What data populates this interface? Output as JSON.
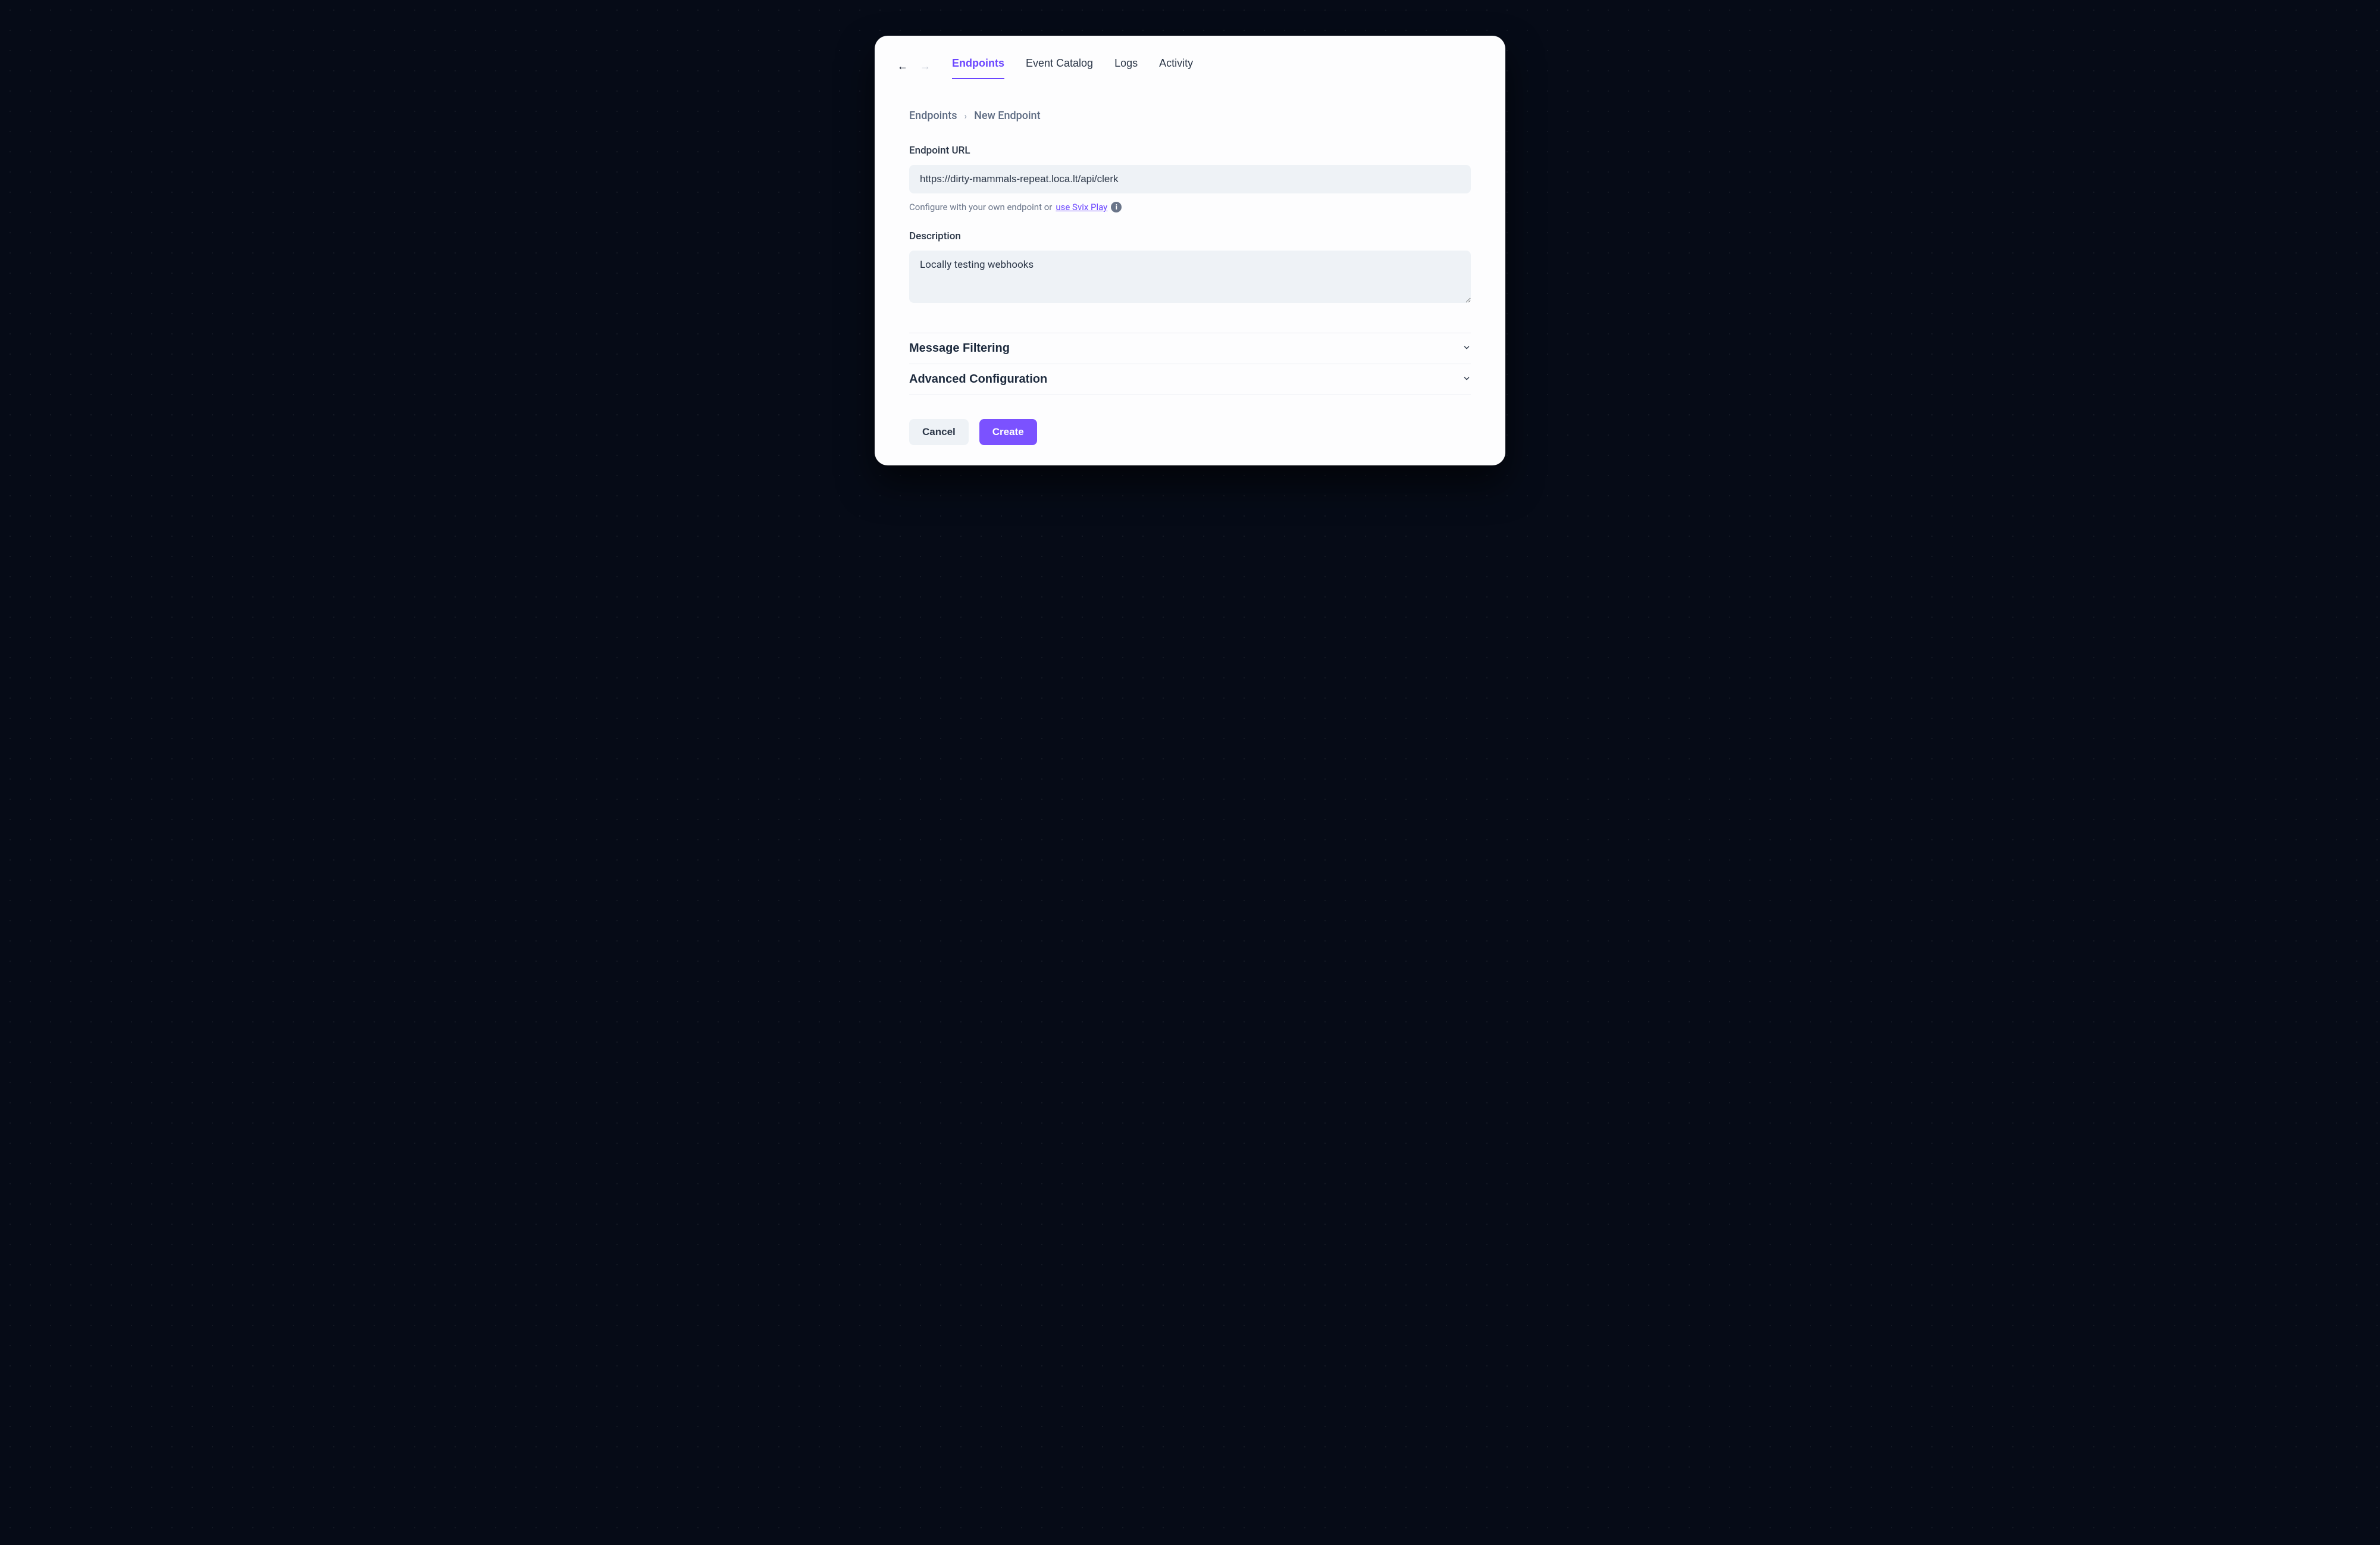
{
  "nav": {
    "tabs": [
      {
        "label": "Endpoints",
        "active": true
      },
      {
        "label": "Event Catalog",
        "active": false
      },
      {
        "label": "Logs",
        "active": false
      },
      {
        "label": "Activity",
        "active": false
      }
    ]
  },
  "breadcrumb": {
    "root": "Endpoints",
    "current": "New Endpoint"
  },
  "form": {
    "url_label": "Endpoint URL",
    "url_value": "https://dirty-mammals-repeat.loca.lt/api/clerk",
    "url_helper_prefix": "Configure with your own endpoint or ",
    "url_helper_link": "use Svix Play",
    "desc_label": "Description",
    "desc_value": "Locally testing webhooks"
  },
  "accordions": [
    {
      "title": "Message Filtering"
    },
    {
      "title": "Advanced Configuration"
    }
  ],
  "buttons": {
    "cancel": "Cancel",
    "create": "Create"
  }
}
